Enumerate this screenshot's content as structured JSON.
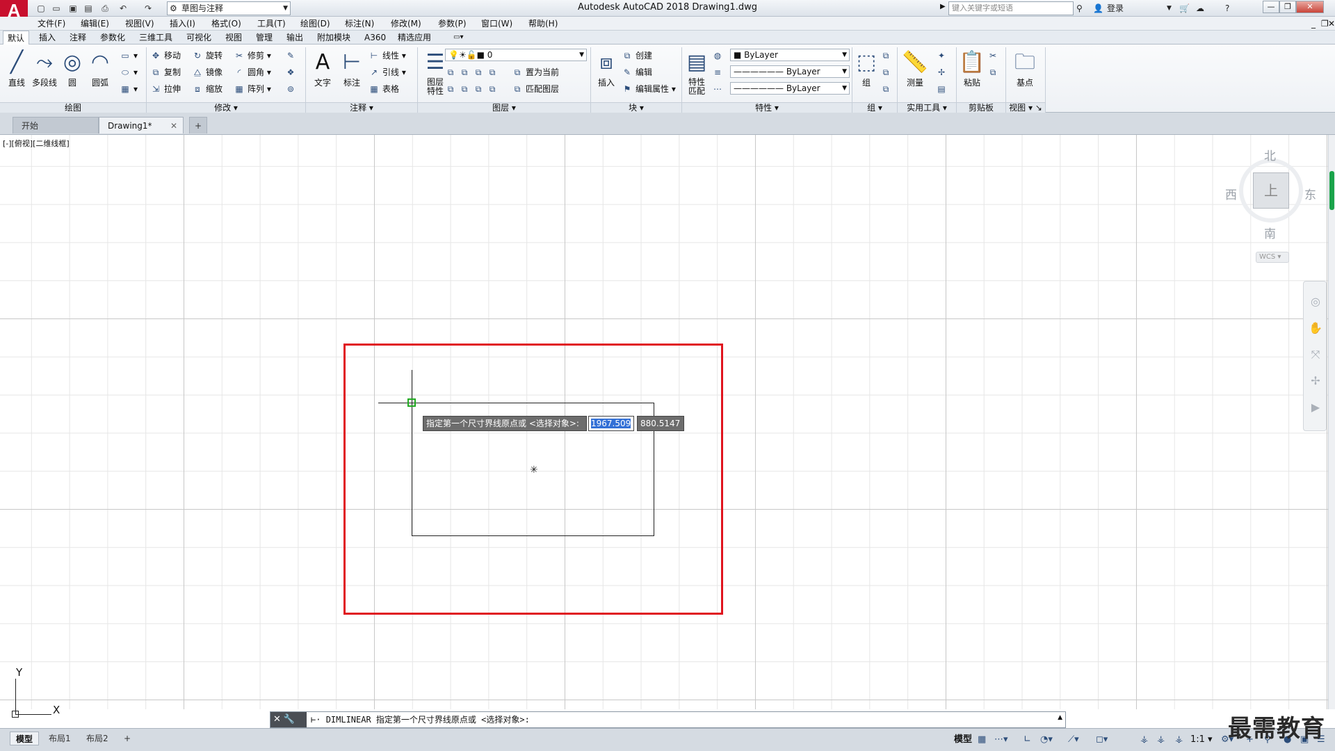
{
  "app": {
    "logo": "A",
    "title": "Autodesk AutoCAD 2018    Drawing1.dwg",
    "workspace": "草图与注释",
    "search_placeholder": "键入关键字或短语",
    "login": "登录"
  },
  "quick_access": [
    "new-icon",
    "open-icon",
    "save-icon",
    "saveas-icon",
    "print-icon",
    "undo-icon",
    "redo-icon"
  ],
  "menu": [
    "文件(F)",
    "编辑(E)",
    "视图(V)",
    "插入(I)",
    "格式(O)",
    "工具(T)",
    "绘图(D)",
    "标注(N)",
    "修改(M)",
    "参数(P)",
    "窗口(W)",
    "帮助(H)"
  ],
  "ribbon_tabs": [
    "默认",
    "插入",
    "注释",
    "参数化",
    "三维工具",
    "可视化",
    "视图",
    "管理",
    "输出",
    "附加模块",
    "A360",
    "精选应用"
  ],
  "ribbon": {
    "draw": {
      "title": "绘图",
      "line": "直线",
      "polyline": "多段线",
      "circle": "圆",
      "arc": "圆弧"
    },
    "modify": {
      "title": "修改",
      "move": "移动",
      "rotate": "旋转",
      "trim": "修剪",
      "copy": "复制",
      "mirror": "镜像",
      "fillet": "圆角",
      "stretch": "拉伸",
      "scale": "缩放",
      "array": "阵列"
    },
    "annotation": {
      "title": "注释",
      "text": "文字",
      "dimension": "标注",
      "linear": "线性",
      "leader": "引线",
      "table": "表格"
    },
    "layers": {
      "title": "图层",
      "properties": "图层\n特性",
      "current_layer": "0",
      "make_current": "置为当前",
      "match_layer": "匹配图层"
    },
    "block": {
      "title": "块",
      "insert": "插入",
      "create": "创建",
      "edit": "编辑",
      "edit_attr": "编辑属性"
    },
    "properties": {
      "title": "特性",
      "match": "特性\n匹配",
      "color": "ByLayer",
      "linetype": "ByLayer",
      "lineweight": "ByLayer"
    },
    "groups": {
      "title": "组",
      "group": "组"
    },
    "utilities": {
      "title": "实用工具",
      "measure": "测量"
    },
    "clipboard": {
      "title": "剪贴板",
      "paste": "粘贴"
    },
    "view": {
      "title": "视图",
      "base": "基点"
    }
  },
  "doc_tabs": [
    {
      "label": "开始"
    },
    {
      "label": "Drawing1*"
    }
  ],
  "viewport_label": "[-][俯视][二维线框]",
  "viewcube": {
    "north": "北",
    "south": "南",
    "east": "东",
    "west": "西",
    "top": "上",
    "wcs": "WCS"
  },
  "dynamic_input": {
    "prompt": "指定第一个尺寸界线原点或 <选择对象>:",
    "x_value": "1967.509",
    "y_value": "880.5147"
  },
  "ucs": {
    "x": "X",
    "y": "Y"
  },
  "command_line": {
    "text": "DIMLINEAR 指定第一个尺寸界线原点或 <选择对象>:"
  },
  "layout_tabs": [
    "模型",
    "布局1",
    "布局2"
  ],
  "status": {
    "model": "模型",
    "scale": "1:1"
  },
  "watermark": "最需教育"
}
